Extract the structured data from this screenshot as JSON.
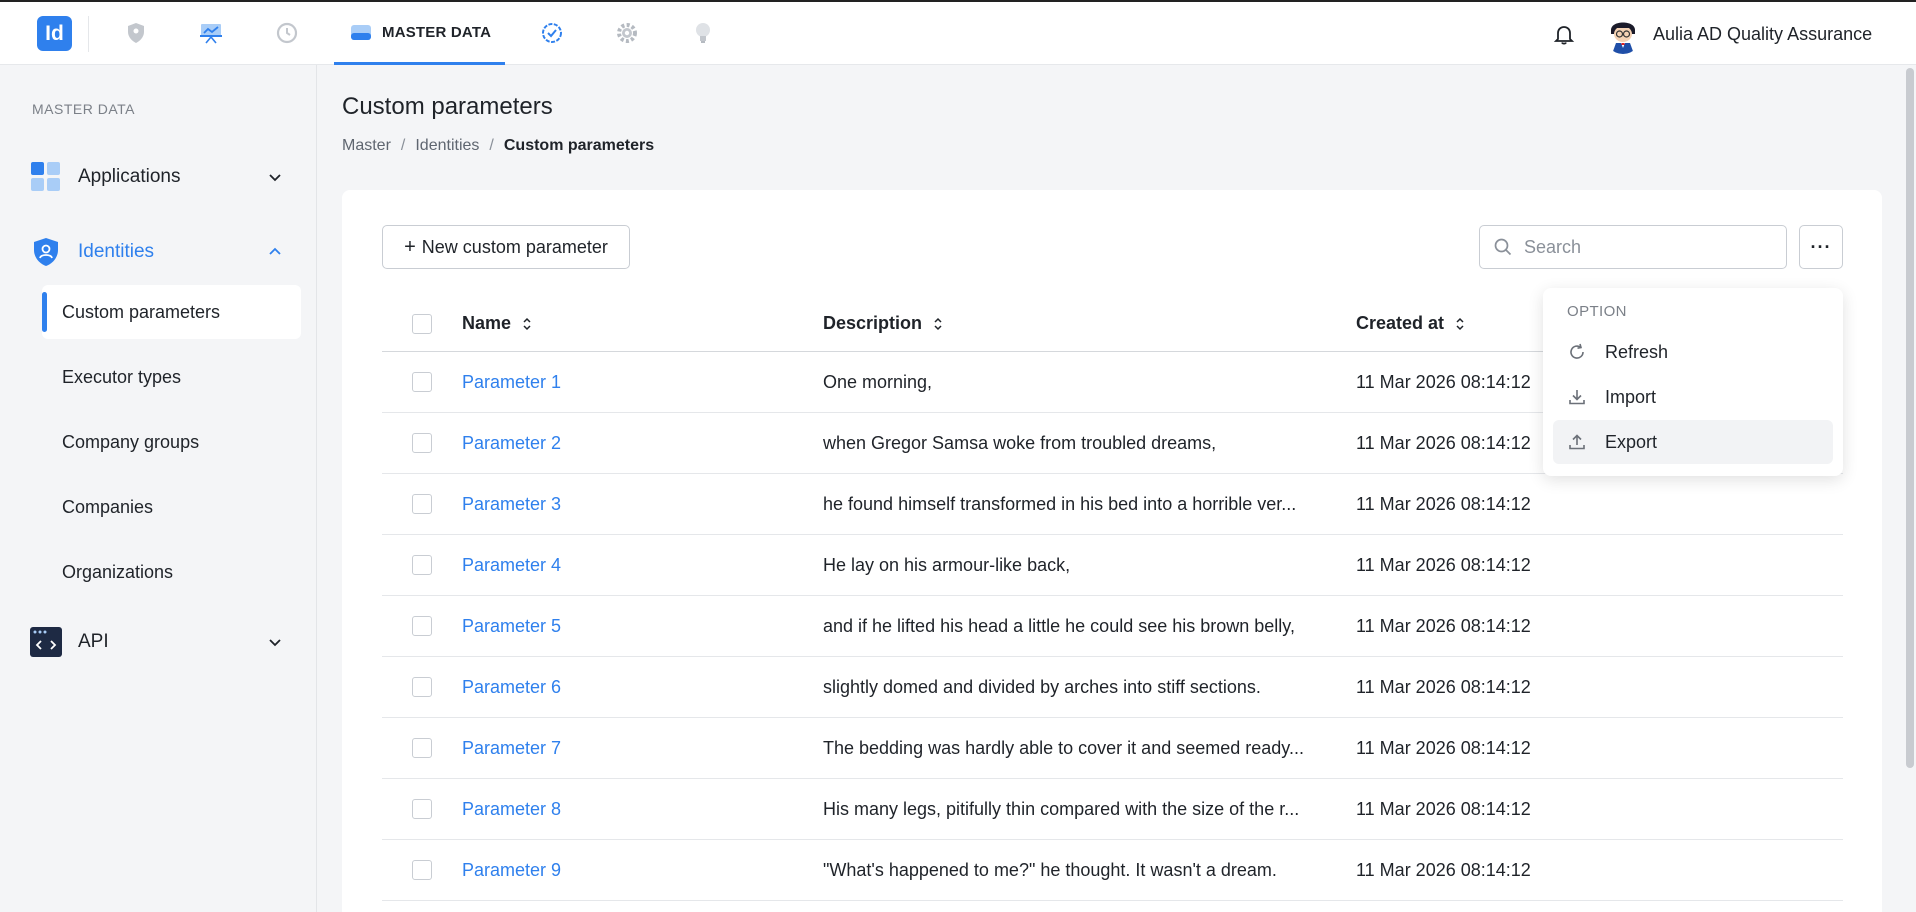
{
  "topbar": {
    "logo_text": "Id",
    "active_tab_label": "MASTER DATA",
    "user_name": "Aulia AD Quality Assurance",
    "nav_icons": [
      "shield-icon",
      "presentation-icon",
      "clock-icon",
      "database-icon",
      "check-badge-icon",
      "gear-icon",
      "lightbulb-icon"
    ]
  },
  "sidebar": {
    "section_title": "MASTER DATA",
    "groups": [
      {
        "label": "Applications",
        "icon": "apps-grid-icon"
      },
      {
        "label": "Identities",
        "icon": "shield-user-icon"
      },
      {
        "label": "API",
        "icon": "code-window-icon"
      }
    ],
    "identities_items": [
      {
        "label": "Custom parameters"
      },
      {
        "label": "Executor types"
      },
      {
        "label": "Company groups"
      },
      {
        "label": "Companies"
      },
      {
        "label": "Organizations"
      }
    ]
  },
  "page": {
    "title": "Custom parameters",
    "breadcrumb": [
      "Master",
      "Identities",
      "Custom parameters"
    ],
    "breadcrumb_sep": "/"
  },
  "toolbar": {
    "new_button_label": "New custom parameter",
    "new_button_plus": "+",
    "search_placeholder": "Search",
    "more_label": "···"
  },
  "table": {
    "columns": {
      "name": "Name",
      "description": "Description",
      "created_at": "Created at"
    },
    "rows": [
      {
        "name": "Parameter 1",
        "description": "One morning,",
        "created_at": "11 Mar 2026 08:14:12"
      },
      {
        "name": "Parameter 2",
        "description": "when Gregor Samsa woke from troubled dreams,",
        "created_at": "11 Mar 2026 08:14:12"
      },
      {
        "name": "Parameter 3",
        "description": "he found himself transformed in his bed into a horrible ver...",
        "created_at": "11 Mar 2026 08:14:12"
      },
      {
        "name": "Parameter 4",
        "description": "He lay on his armour-like back,",
        "created_at": "11 Mar 2026 08:14:12"
      },
      {
        "name": "Parameter 5",
        "description": "and if he lifted his head a little he could see his brown belly,",
        "created_at": "11 Mar 2026 08:14:12"
      },
      {
        "name": "Parameter 6",
        "description": "slightly domed and divided by arches into stiff sections.",
        "created_at": "11 Mar 2026 08:14:12"
      },
      {
        "name": "Parameter 7",
        "description": "The bedding was hardly able to cover it and seemed ready...",
        "created_at": "11 Mar 2026 08:14:12"
      },
      {
        "name": "Parameter 8",
        "description": "His many legs, pitifully thin compared with the size of the r...",
        "created_at": "11 Mar 2026 08:14:12"
      },
      {
        "name": "Parameter 9",
        "description": "\"What's happened to me?\" he thought. It wasn't a dream.",
        "created_at": "11 Mar 2026 08:14:12"
      }
    ]
  },
  "dropdown": {
    "title": "OPTION",
    "items": [
      {
        "label": "Refresh",
        "icon": "refresh-icon"
      },
      {
        "label": "Import",
        "icon": "download-icon"
      },
      {
        "label": "Export",
        "icon": "upload-icon"
      }
    ]
  },
  "colors": {
    "accent": "#2f80ed",
    "text": "#1f2329",
    "muted": "#7b8088",
    "background": "#f4f5f7"
  }
}
